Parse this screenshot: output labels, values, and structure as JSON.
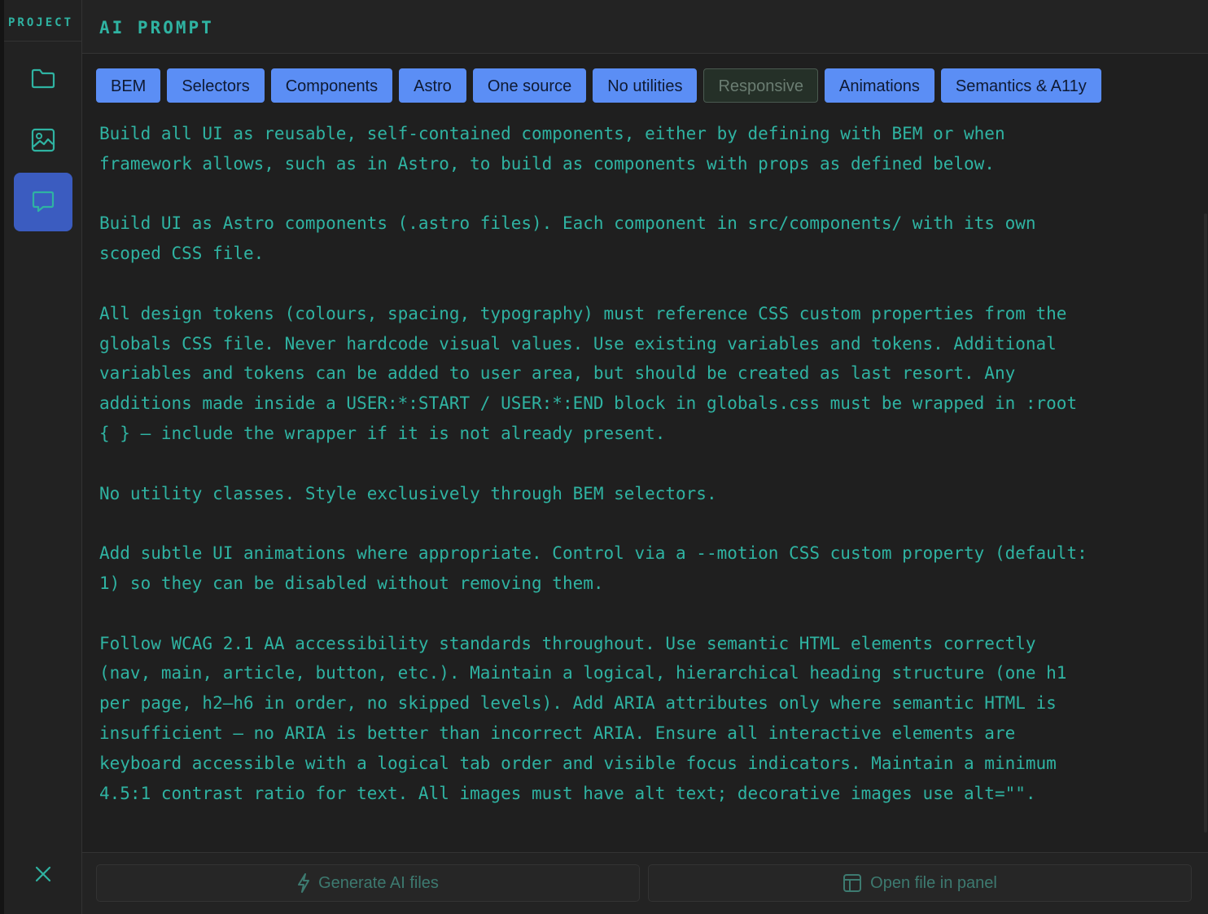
{
  "sidebar": {
    "label": "PROJECT",
    "items": [
      {
        "name": "files",
        "icon": "folder-icon"
      },
      {
        "name": "images",
        "icon": "image-icon"
      },
      {
        "name": "prompt",
        "icon": "chat-icon",
        "active": true
      }
    ],
    "close_icon": "close-icon"
  },
  "header": {
    "title": "AI PROMPT"
  },
  "tabs": [
    {
      "label": "BEM",
      "active": true
    },
    {
      "label": "Selectors",
      "active": true
    },
    {
      "label": "Components",
      "active": true
    },
    {
      "label": "Astro",
      "active": true
    },
    {
      "label": "One source",
      "active": true
    },
    {
      "label": "No utilities",
      "active": true
    },
    {
      "label": "Responsive",
      "active": false
    },
    {
      "label": "Animations",
      "active": true
    },
    {
      "label": "Semantics & A11y",
      "active": true
    }
  ],
  "paragraphs": [
    "Build all UI as reusable, self-contained components, either by defining with BEM or when\nframework allows, such as in Astro, to build as components with props as defined below.",
    "Build UI as Astro components (.astro files). Each component in src/components/ with its own\nscoped CSS file.",
    "All design tokens (colours, spacing, typography) must reference CSS custom properties from the\nglobals CSS file. Never hardcode visual values. Use existing variables and tokens. Additional\nvariables and tokens can be added to user area, but should be created as last resort. Any\nadditions made inside a USER:*:START / USER:*:END block in globals.css must be wrapped in :root\n{ } — include the wrapper if it is not already present.",
    "No utility classes. Style exclusively through BEM selectors.",
    "Add subtle UI animations where appropriate. Control via a --motion CSS custom property (default:\n1) so they can be disabled without removing them.",
    "Follow WCAG 2.1 AA accessibility standards throughout. Use semantic HTML elements correctly\n(nav, main, article, button, etc.). Maintain a logical, hierarchical heading structure (one h1\nper page, h2–h6 in order, no skipped levels). Add ARIA attributes only where semantic HTML is\ninsufficient — no ARIA is better than incorrect ARIA. Ensure all interactive elements are\nkeyboard accessible with a logical tab order and visible focus indicators. Maintain a minimum\n4.5:1 contrast ratio for text. All images must have alt text; decorative images use alt=\"\"."
  ],
  "footer": {
    "generate_label": "Generate AI files",
    "generate_icon": "lightning-icon",
    "open_label": "Open file in panel",
    "open_icon": "panel-icon"
  },
  "colors": {
    "accent": "#2fb3a2",
    "tab_active": "#5b8ef5",
    "rail_active": "#3b5cc0",
    "background": "#1f1f1f"
  }
}
